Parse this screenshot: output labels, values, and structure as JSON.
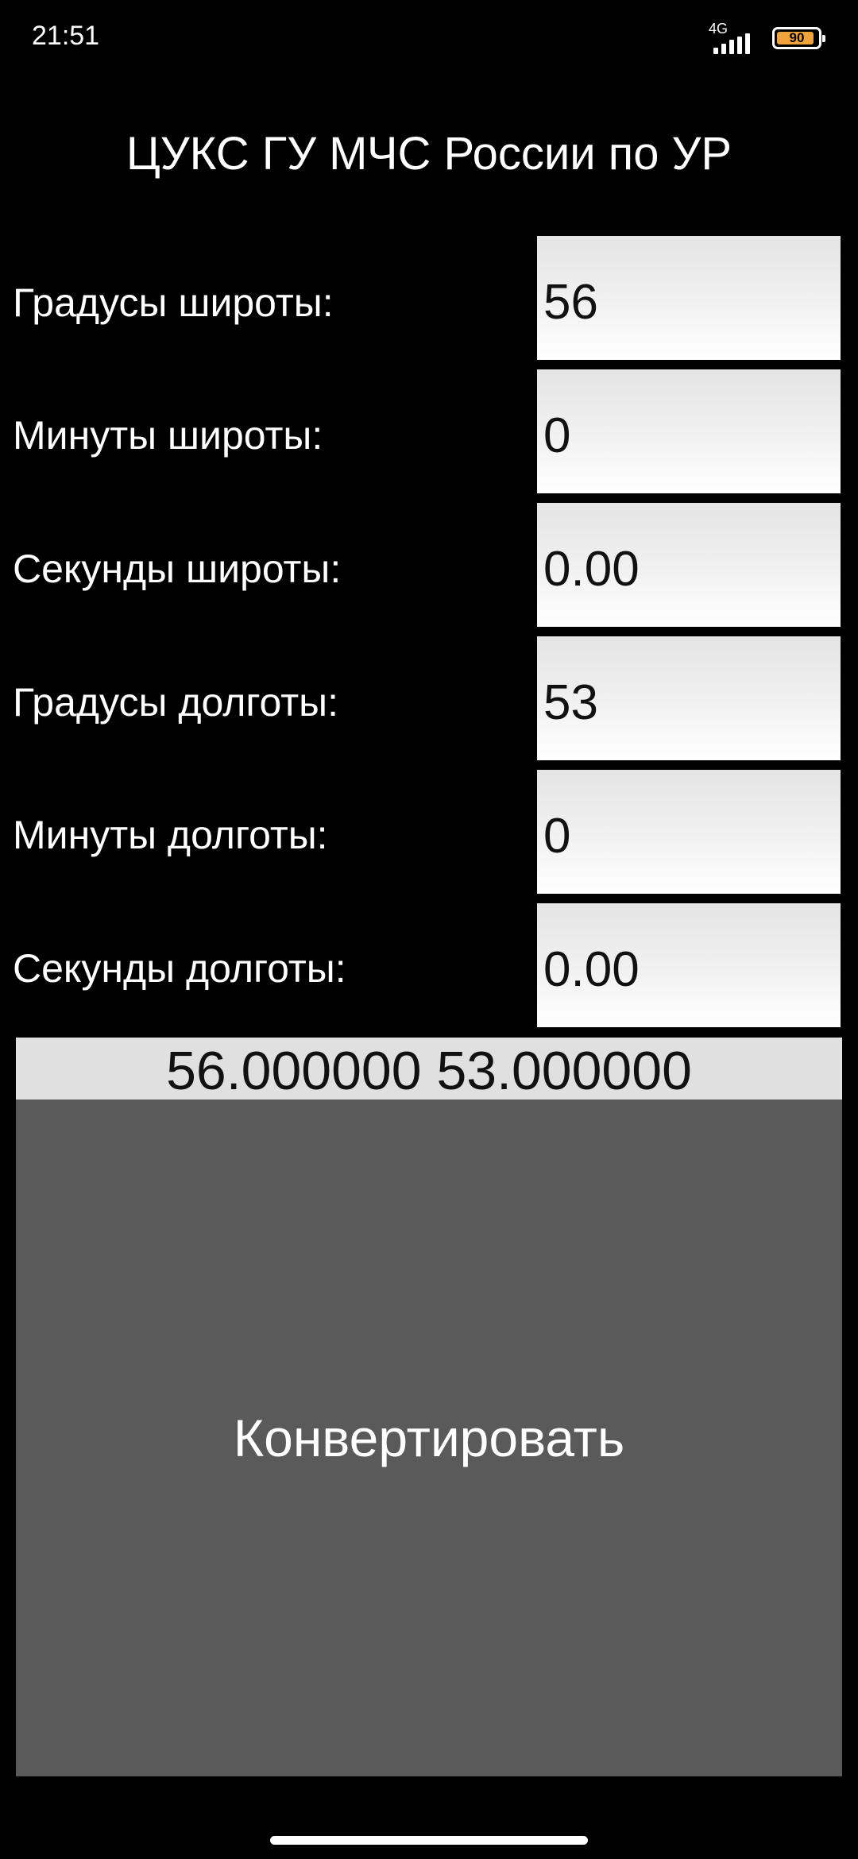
{
  "status_bar": {
    "time": "21:51",
    "network": "4G",
    "battery": "90",
    "battery_color": "#f2a23a"
  },
  "app": {
    "title": "ЦУКС ГУ МЧС России по УР"
  },
  "fields": {
    "lat_degrees": {
      "label": "Градусы широты:",
      "value": "56"
    },
    "lat_minutes": {
      "label": "Минуты широты:",
      "value": "0"
    },
    "lat_seconds": {
      "label": "Секунды широты:",
      "value": "0.00"
    },
    "lon_degrees": {
      "label": "Градусы долготы:",
      "value": "53"
    },
    "lon_minutes": {
      "label": "Минуты долготы:",
      "value": "0"
    },
    "lon_seconds": {
      "label": "Секунды долготы:",
      "value": "0.00"
    }
  },
  "result": {
    "text": "56.000000 53.000000"
  },
  "actions": {
    "convert_label": "Конвертировать"
  },
  "colors": {
    "background": "#000000",
    "button": "#5a5a5a",
    "result_bg": "#e0e0e0"
  }
}
